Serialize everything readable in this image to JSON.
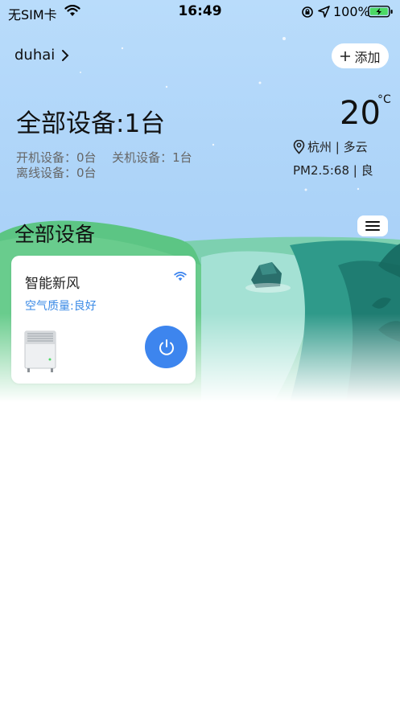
{
  "status_bar": {
    "carrier": "无SIM卡",
    "time": "16:49",
    "battery_percent": "100%"
  },
  "header": {
    "username": "duhai",
    "add_label": "添加"
  },
  "summary": {
    "title": "全部设备:1台",
    "on_devices": "开机设备：0台",
    "off_devices": "关机设备：1台",
    "offline_devices": "离线设备：0台"
  },
  "weather": {
    "temperature": "20",
    "unit": "°C",
    "location": "杭州 | 多云",
    "pm": "PM2.5:68 | 良"
  },
  "section": {
    "title": "全部设备"
  },
  "devices": [
    {
      "name": "智能新风",
      "air_quality": "空气质量:良好",
      "online": true,
      "power": "off"
    }
  ],
  "icons": [
    "wifi-icon",
    "orientation-lock-icon",
    "location-arrow-icon",
    "battery-charging-icon",
    "chevron-right-icon",
    "plus-icon",
    "location-pin-icon",
    "menu-icon",
    "power-icon",
    "air-purifier-image"
  ],
  "colors": {
    "accent": "#3d85ee",
    "air_quality_text": "#3a8ae6",
    "sky": "#acd3f8",
    "battery": "#4cd964"
  }
}
